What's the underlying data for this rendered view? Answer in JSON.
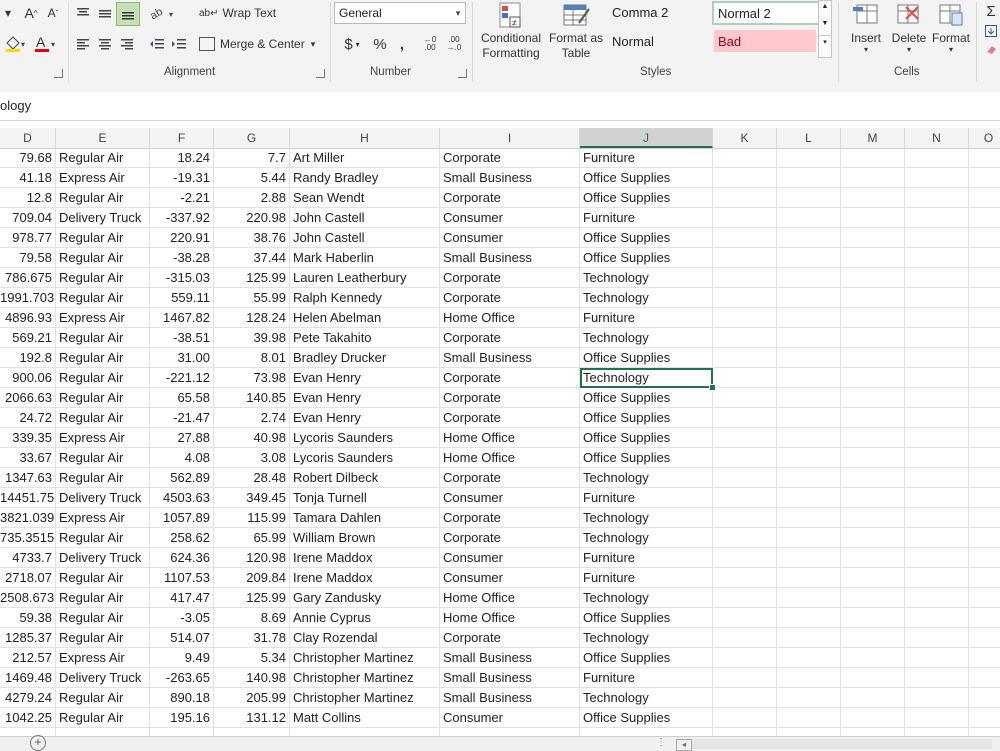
{
  "ribbon": {
    "alignment": {
      "wrap_text": "Wrap Text",
      "merge_center": "Merge & Center",
      "group_label": "Alignment"
    },
    "number": {
      "format_value": "General",
      "currency_symbol": "$",
      "percent_symbol": "%",
      "comma_symbol": ",",
      "group_label": "Number"
    },
    "styles": {
      "conditional_formatting": "Conditional Formatting",
      "format_as_table": "Format as Table",
      "comma2": "Comma 2",
      "normal2": "Normal 2",
      "normal": "Normal",
      "bad": "Bad",
      "group_label": "Styles",
      "bad_bg": "#ffc7ce",
      "bad_fg": "#9c0006",
      "normal2_border": "#a9d3b6"
    },
    "cells": {
      "insert": "Insert",
      "delete": "Delete",
      "format": "Format",
      "group_label": "Cells"
    }
  },
  "formula_bar": {
    "partial_text": "ology"
  },
  "columns": [
    "D",
    "E",
    "F",
    "G",
    "H",
    "I",
    "J",
    "K",
    "L",
    "M",
    "N",
    "O"
  ],
  "selected_column": "J",
  "rows": [
    [
      "79.68",
      "Regular Air",
      "18.24",
      "7.7",
      "Art Miller",
      "Corporate",
      "Furniture"
    ],
    [
      "41.18",
      "Express Air",
      "-19.31",
      "5.44",
      "Randy Bradley",
      "Small Business",
      "Office Supplies"
    ],
    [
      "12.8",
      "Regular Air",
      "-2.21",
      "2.88",
      "Sean Wendt",
      "Corporate",
      "Office Supplies"
    ],
    [
      "709.04",
      "Delivery Truck",
      "-337.92",
      "220.98",
      "John Castell",
      "Consumer",
      "Furniture"
    ],
    [
      "978.77",
      "Regular Air",
      "220.91",
      "38.76",
      "John Castell",
      "Consumer",
      "Office Supplies"
    ],
    [
      "79.58",
      "Regular Air",
      "-38.28",
      "37.44",
      "Mark Haberlin",
      "Small Business",
      "Office Supplies"
    ],
    [
      "786.675",
      "Regular Air",
      "-315.03",
      "125.99",
      "Lauren Leatherbury",
      "Corporate",
      "Technology"
    ],
    [
      "1991.703",
      "Regular Air",
      "559.11",
      "55.99",
      "Ralph Kennedy",
      "Corporate",
      "Technology"
    ],
    [
      "4896.93",
      "Express Air",
      "1467.82",
      "128.24",
      "Helen Abelman",
      "Home Office",
      "Furniture"
    ],
    [
      "569.21",
      "Regular Air",
      "-38.51",
      "39.98",
      "Pete Takahito",
      "Corporate",
      "Technology"
    ],
    [
      "192.8",
      "Regular Air",
      "31.00",
      "8.01",
      "Bradley Drucker",
      "Small Business",
      "Office Supplies"
    ],
    [
      "900.06",
      "Regular Air",
      "-221.12",
      "73.98",
      "Evan Henry",
      "Corporate",
      "Technology"
    ],
    [
      "2066.63",
      "Regular Air",
      "65.58",
      "140.85",
      "Evan Henry",
      "Corporate",
      "Office Supplies"
    ],
    [
      "24.72",
      "Regular Air",
      "-21.47",
      "2.74",
      "Evan Henry",
      "Corporate",
      "Office Supplies"
    ],
    [
      "339.35",
      "Express Air",
      "27.88",
      "40.98",
      "Lycoris Saunders",
      "Home Office",
      "Office Supplies"
    ],
    [
      "33.67",
      "Regular Air",
      "4.08",
      "3.08",
      "Lycoris Saunders",
      "Home Office",
      "Office Supplies"
    ],
    [
      "1347.63",
      "Regular Air",
      "562.89",
      "28.48",
      "Robert Dilbeck",
      "Corporate",
      "Technology"
    ],
    [
      "14451.75",
      "Delivery Truck",
      "4503.63",
      "349.45",
      "Tonja Turnell",
      "Consumer",
      "Furniture"
    ],
    [
      "3821.039",
      "Express Air",
      "1057.89",
      "115.99",
      "Tamara Dahlen",
      "Corporate",
      "Technology"
    ],
    [
      "735.3515",
      "Regular Air",
      "258.62",
      "65.99",
      "William Brown",
      "Corporate",
      "Technology"
    ],
    [
      "4733.7",
      "Delivery Truck",
      "624.36",
      "120.98",
      "Irene Maddox",
      "Consumer",
      "Furniture"
    ],
    [
      "2718.07",
      "Regular Air",
      "1107.53",
      "209.84",
      "Irene Maddox",
      "Consumer",
      "Furniture"
    ],
    [
      "2508.673",
      "Regular Air",
      "417.47",
      "125.99",
      "Gary Zandusky",
      "Home Office",
      "Technology"
    ],
    [
      "59.38",
      "Regular Air",
      "-3.05",
      "8.69",
      "Annie Cyprus",
      "Home Office",
      "Office Supplies"
    ],
    [
      "1285.37",
      "Regular Air",
      "514.07",
      "31.78",
      "Clay Rozendal",
      "Corporate",
      "Technology"
    ],
    [
      "212.57",
      "Express Air",
      "9.49",
      "5.34",
      "Christopher Martinez",
      "Small Business",
      "Office Supplies"
    ],
    [
      "1469.48",
      "Delivery Truck",
      "-263.65",
      "140.98",
      "Christopher Martinez",
      "Small Business",
      "Furniture"
    ],
    [
      "4279.24",
      "Regular Air",
      "890.18",
      "205.99",
      "Christopher Martinez",
      "Small Business",
      "Technology"
    ],
    [
      "1042.25",
      "Regular Air",
      "195.16",
      "131.12",
      "Matt Collins",
      "Consumer",
      "Office Supplies"
    ]
  ],
  "active_cell": {
    "row": 11,
    "col": 6
  },
  "accent_color": "#217346"
}
